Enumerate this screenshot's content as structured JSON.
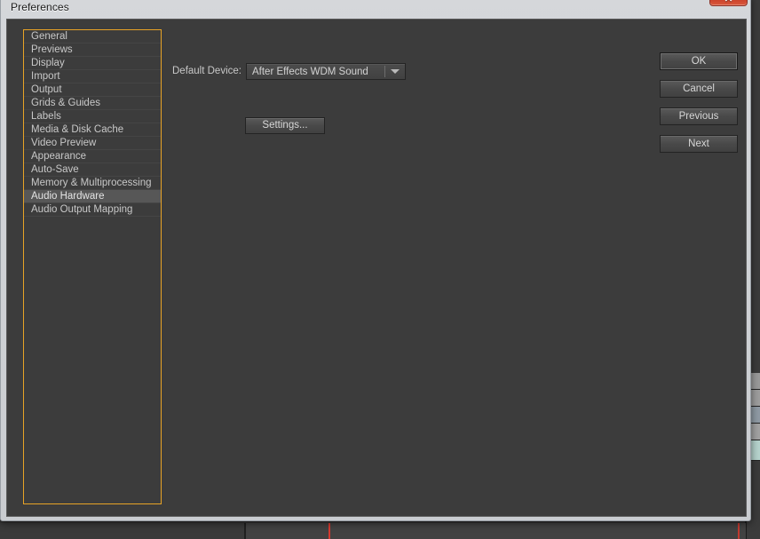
{
  "window": {
    "title": "Preferences",
    "close_label": "✕",
    "accent_focus_color": "#e8a326",
    "panel_bg_color": "#3c3c3c",
    "titlebar_bg_color": "#d5d7da",
    "close_button_color": "#d9452c"
  },
  "sidebar": {
    "selected_index": 12,
    "items": [
      {
        "label": "General"
      },
      {
        "label": "Previews"
      },
      {
        "label": "Display"
      },
      {
        "label": "Import"
      },
      {
        "label": "Output"
      },
      {
        "label": "Grids & Guides"
      },
      {
        "label": "Labels"
      },
      {
        "label": "Media & Disk Cache"
      },
      {
        "label": "Video Preview"
      },
      {
        "label": "Appearance"
      },
      {
        "label": "Auto-Save"
      },
      {
        "label": "Memory & Multiprocessing"
      },
      {
        "label": "Audio Hardware"
      },
      {
        "label": "Audio Output Mapping"
      }
    ]
  },
  "main": {
    "default_device_label": "Default Device:",
    "default_device_value": "After Effects WDM Sound",
    "settings_button": "Settings..."
  },
  "actions": {
    "ok": "OK",
    "cancel": "Cancel",
    "previous": "Previous",
    "next": "Next"
  }
}
